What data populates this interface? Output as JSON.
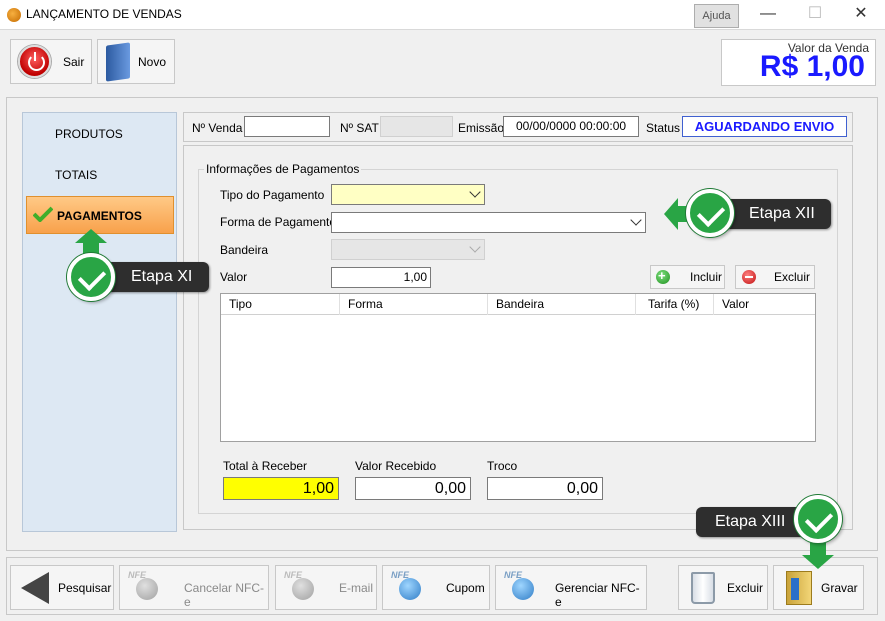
{
  "window": {
    "title": "LANÇAMENTO DE VENDAS",
    "help_label": "Ajuda",
    "min_glyph": "—",
    "max_glyph": "☐",
    "close_glyph": "✕"
  },
  "toolbar": {
    "sair_label": "Sair",
    "novo_label": "Novo",
    "valor_label": "Valor da Venda",
    "valor_value": "R$ 1,00"
  },
  "sidebar": {
    "items": [
      {
        "label": "PRODUTOS"
      },
      {
        "label": "TOTAIS"
      },
      {
        "label": "PAGAMENTOS",
        "active": true
      }
    ]
  },
  "header": {
    "nvenda_label": "Nº Venda",
    "nvenda_value": "",
    "nsat_label": "Nº SAT",
    "nsat_value": "",
    "emissao_label": "Emissão",
    "emissao_value": "00/00/0000 00:00:00",
    "status_label": "Status",
    "status_value": "AGUARDANDO ENVIO"
  },
  "payments": {
    "group_title": "Informações de Pagamentos",
    "tipo_label": "Tipo do Pagamento",
    "tipo_value": "",
    "forma_label": "Forma de Pagamento",
    "forma_value": "",
    "bandeira_label": "Bandeira",
    "bandeira_value": "",
    "valor_label": "Valor",
    "valor_value": "1,00",
    "incluir_label": "Incluir",
    "excluir_label": "Excluir",
    "table": {
      "columns": [
        "Tipo",
        "Forma",
        "Bandeira",
        "Tarifa (%)",
        "Valor"
      ],
      "rows": []
    }
  },
  "totals": {
    "total_label": "Total à Receber",
    "total_value": "1,00",
    "recebido_label": "Valor Recebido",
    "recebido_value": "0,00",
    "troco_label": "Troco",
    "troco_value": "0,00"
  },
  "bottom_bar": {
    "pesquisar_label": "Pesquisar",
    "cancelar_label": "Cancelar NFC-e",
    "email_label": "E-mail",
    "cupom_label": "Cupom",
    "gerenciar_label": "Gerenciar NFC-e",
    "excluir_label": "Excluir",
    "gravar_label": "Gravar",
    "nfe_tag": "NFE"
  },
  "callouts": {
    "etapa_xi": "Etapa XI",
    "etapa_xii": "Etapa XII",
    "etapa_xiii": "Etapa XIII"
  },
  "colors": {
    "accent_blue": "#1a1aff",
    "active_tab": "#f8a14b",
    "total_highlight": "#ffff00",
    "callout_green": "#29a545"
  }
}
